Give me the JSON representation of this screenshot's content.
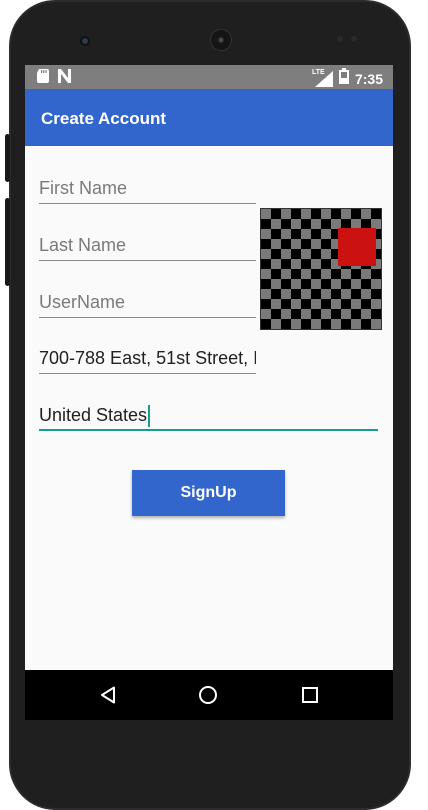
{
  "status_bar": {
    "time": "7:35",
    "network": "LTE",
    "icons": [
      "sd-card-icon",
      "n-notification-icon",
      "signal-icon",
      "battery-icon"
    ]
  },
  "app_bar": {
    "title": "Create Account"
  },
  "form": {
    "first_name": {
      "placeholder": "First Name",
      "value": ""
    },
    "last_name": {
      "placeholder": "Last Name",
      "value": ""
    },
    "username": {
      "placeholder": "UserName",
      "value": ""
    },
    "address": {
      "placeholder": "",
      "value": "700-788 East, 51st Street, I"
    },
    "country": {
      "placeholder": "",
      "value": "United States"
    }
  },
  "signup_label": "SignUp",
  "colors": {
    "app_bar": "#3366cc",
    "button": "#3366cc",
    "focus_accent": "#169e8a",
    "status_bar": "#7e7e7e",
    "image_accent": "#cc1111"
  },
  "nav_bar": {
    "icons": [
      "back-icon",
      "home-icon",
      "recents-icon"
    ]
  }
}
